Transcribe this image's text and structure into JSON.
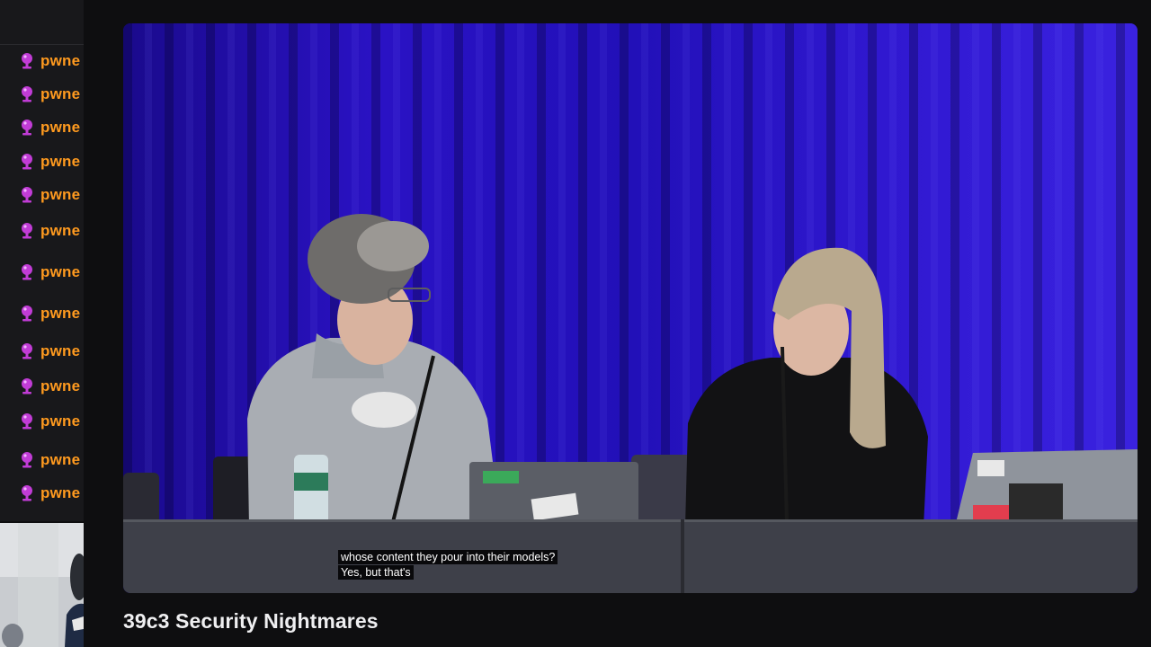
{
  "chat": {
    "messages": [
      {
        "user": "pwne",
        "badge": "microphone-badge-icon"
      },
      {
        "user": "pwne",
        "badge": "microphone-badge-icon"
      },
      {
        "user": "pwne",
        "badge": "microphone-badge-icon"
      },
      {
        "user": "pwne",
        "badge": "microphone-badge-icon"
      },
      {
        "user": "pwne",
        "badge": "microphone-badge-icon"
      },
      {
        "user": "pwne",
        "badge": "microphone-badge-icon"
      },
      {
        "user": "pwne",
        "badge": "microphone-badge-icon"
      },
      {
        "user": "pwne",
        "badge": "microphone-badge-icon"
      },
      {
        "user": "pwne",
        "badge": "microphone-badge-icon"
      },
      {
        "user": "pwne",
        "badge": "microphone-badge-icon"
      },
      {
        "user": "pwne",
        "badge": "microphone-badge-icon"
      },
      {
        "user": "pwne",
        "badge": "microphone-badge-icon"
      },
      {
        "user": "pwne",
        "badge": "microphone-badge-icon"
      }
    ],
    "username_color": "#ff9a1f",
    "badge_color": "#c13cd6"
  },
  "video": {
    "captions": [
      "whose content they pour into their models?",
      "Yes, but that's"
    ],
    "curtain_color": "#2b12c8"
  },
  "stream": {
    "title": "39c3 Security Nightmares"
  }
}
